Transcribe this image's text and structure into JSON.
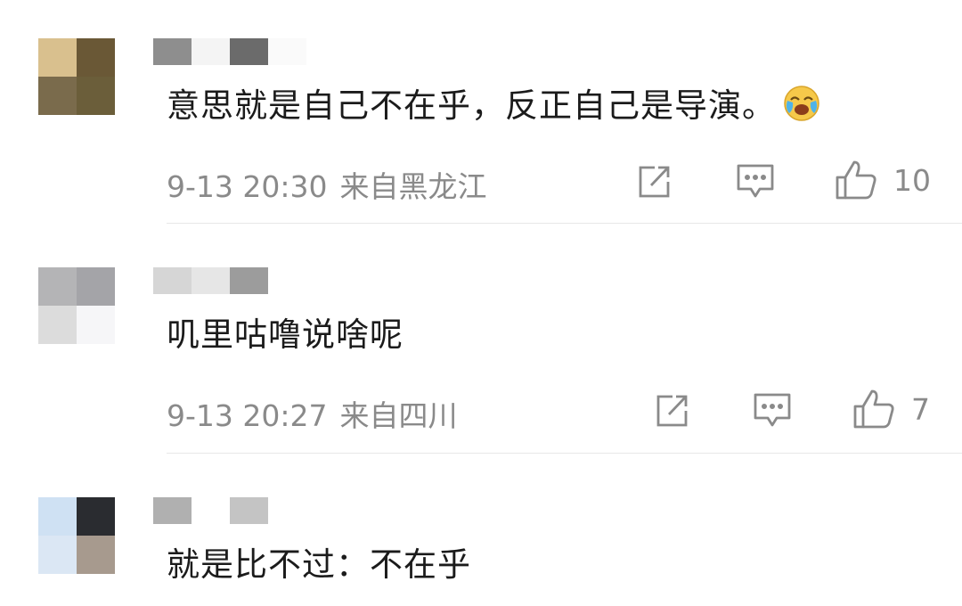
{
  "comments": [
    {
      "text": "意思就是自己不在乎，反正自己是导演。",
      "time": "9-13 20:30",
      "location": "来自黑龙江",
      "likes": "10",
      "emoji": "laugh-cry-icon",
      "avatar_colors": [
        "#d9c08e",
        "#6a5836",
        "#7a6b4c",
        "#6b5e3a"
      ]
    },
    {
      "text": "叽里咕噜说啥呢",
      "time": "9-13 20:27",
      "location": "来自四川",
      "likes": "7",
      "avatar_colors": [
        "#b4b4b6",
        "#a4a4a8",
        "#dcdcdc",
        "#f6f6f8"
      ]
    },
    {
      "text": "就是比不过：不在乎",
      "avatar_colors": [
        "#cfe1f3",
        "#2a2c30",
        "#dbe7f4",
        "#a79a8e"
      ]
    }
  ],
  "icons": {
    "share": "share-icon",
    "comment": "comment-icon",
    "like": "thumbs-up-icon"
  }
}
